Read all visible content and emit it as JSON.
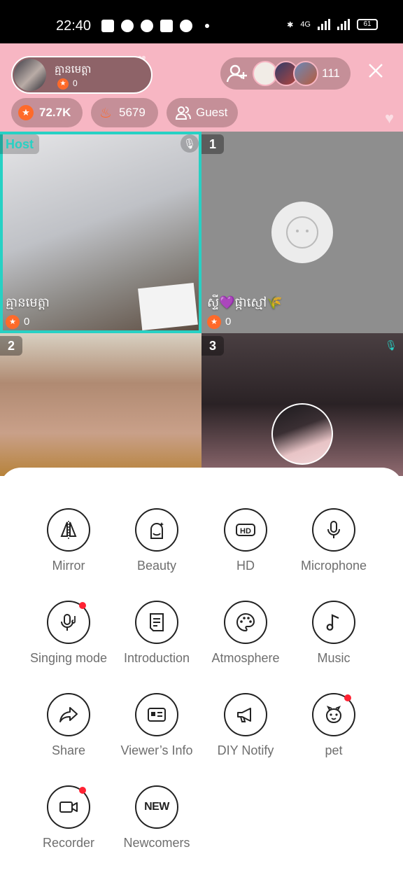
{
  "status_bar": {
    "time": "22:40",
    "network": "4G",
    "battery": "61"
  },
  "header": {
    "host": {
      "name": "គ្មានមេត្តា",
      "score": "0"
    },
    "viewer_count": "111",
    "stats": {
      "stars": "72.7K",
      "fire": "5679",
      "guest_label": "Guest"
    }
  },
  "seats": [
    {
      "tag": "Host",
      "name": "គ្មានមេត្តា",
      "score": "0"
    },
    {
      "number": "1",
      "name": "ស្ទី💜ផ្កាស្មៅ🌾",
      "score": "0"
    },
    {
      "number": "2"
    },
    {
      "number": "3"
    }
  ],
  "menu": [
    {
      "label": "Mirror",
      "icon": "mirror-icon"
    },
    {
      "label": "Beauty",
      "icon": "beauty-icon"
    },
    {
      "label": "HD",
      "icon": "hd-icon"
    },
    {
      "label": "Microphone",
      "icon": "microphone-icon"
    },
    {
      "label": "Singing mode",
      "icon": "singing-mic-icon"
    },
    {
      "label": "Introduction",
      "icon": "document-icon"
    },
    {
      "label": "Atmosphere",
      "icon": "palette-icon"
    },
    {
      "label": "Music",
      "icon": "music-note-icon"
    },
    {
      "label": "Share",
      "icon": "share-arrow-icon"
    },
    {
      "label": "Viewer’s Info",
      "icon": "id-card-icon"
    },
    {
      "label": "DIY Notify",
      "icon": "megaphone-icon"
    },
    {
      "label": "pet",
      "icon": "pet-icon"
    },
    {
      "label": "Recorder",
      "icon": "video-camera-icon"
    },
    {
      "label": "Newcomers",
      "icon": "new-badge-icon",
      "icon_text": "NEW"
    }
  ],
  "colors": {
    "header_pink": "#f7b6c3",
    "host_highlight": "#27d1c4",
    "badge_orange": "#ff6a2a",
    "notification_red": "#ff2233"
  }
}
